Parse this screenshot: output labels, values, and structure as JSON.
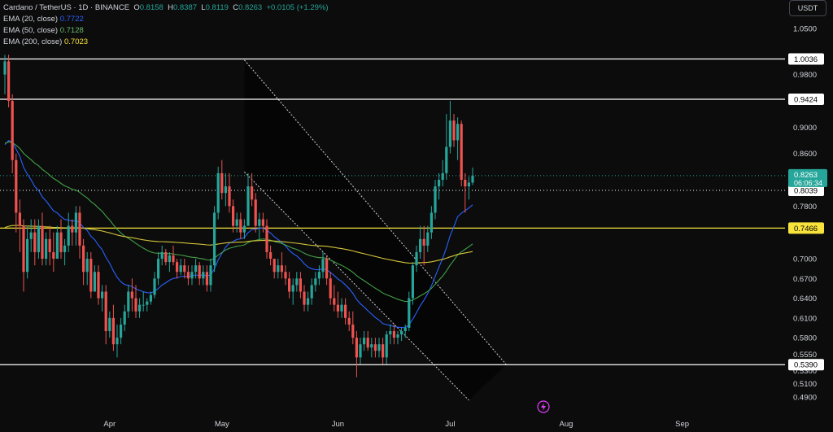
{
  "header": {
    "symbol": "Cardano / TetherUS · 1D · BINANCE",
    "o_label": "O",
    "o_value": "0.8158",
    "h_label": "H",
    "h_value": "0.8387",
    "l_label": "L",
    "l_value": "0.8119",
    "c_label": "C",
    "c_value": "0.8263",
    "change": "+0.0105 (+1.29%)",
    "currency": "USDT"
  },
  "indicators": [
    {
      "label": "EMA (20, close)",
      "value": "0.7722",
      "color": "#2962ff"
    },
    {
      "label": "EMA (50, close)",
      "value": "0.7128",
      "color": "#43a047"
    },
    {
      "label": "EMA (200, close)",
      "value": "0.7023",
      "color": "#f7e33b"
    }
  ],
  "chart_data": {
    "type": "candlestick",
    "y_ticks": [
      1.05,
      0.98,
      0.9,
      0.86,
      0.78,
      0.7,
      0.67,
      0.64,
      0.61,
      0.58,
      0.555,
      0.53,
      0.51,
      0.49
    ],
    "y_tick_labels": [
      "1.0500",
      "0.9800",
      "0.9000",
      "0.8600",
      "0.7800",
      "0.7000",
      "0.6700",
      "0.6400",
      "0.6100",
      "0.5800",
      "0.5550",
      "0.5300",
      "0.5100",
      "0.4900"
    ],
    "x_ticks": [
      {
        "label": "Apr",
        "index": 28
      },
      {
        "label": "May",
        "index": 58
      },
      {
        "label": "Jun",
        "index": 89
      },
      {
        "label": "Jul",
        "index": 119
      },
      {
        "label": "Aug",
        "index": 150
      },
      {
        "label": "Sep",
        "index": 181
      }
    ],
    "horizontal_levels": [
      {
        "value": 1.0036,
        "label": "1.0036",
        "color": "#ffffff",
        "style": "solid"
      },
      {
        "value": 0.9424,
        "label": "0.9424",
        "color": "#ffffff",
        "style": "solid"
      },
      {
        "value": 0.8039,
        "label": "0.8039",
        "color": "#ffffff",
        "style": "dotted"
      },
      {
        "value": 0.7466,
        "label": "0.7466",
        "color": "#f7e33b",
        "style": "solid"
      },
      {
        "value": 0.539,
        "label": "0.5390",
        "color": "#ffffff",
        "style": "solid"
      }
    ],
    "current_price": {
      "value": 0.8263,
      "label": "0.8263",
      "countdown": "06:06:34",
      "color": "#26a69a"
    },
    "channel": {
      "upper": [
        [
          64,
          1.002
        ],
        [
          134,
          0.539
        ]
      ],
      "lower": [
        [
          64,
          0.832
        ],
        [
          124,
          0.485
        ]
      ]
    },
    "candles": [
      [
        0.98,
        1.01,
        0.95,
        1.0
      ],
      [
        1.0,
        1.01,
        0.93,
        0.94
      ],
      [
        0.94,
        0.95,
        0.83,
        0.85
      ],
      [
        0.85,
        0.86,
        0.74,
        0.77
      ],
      [
        0.77,
        0.79,
        0.71,
        0.75
      ],
      [
        0.75,
        0.76,
        0.65,
        0.68
      ],
      [
        0.68,
        0.75,
        0.67,
        0.73
      ],
      [
        0.73,
        0.76,
        0.71,
        0.74
      ],
      [
        0.74,
        0.76,
        0.69,
        0.71
      ],
      [
        0.71,
        0.76,
        0.7,
        0.75
      ],
      [
        0.75,
        0.77,
        0.69,
        0.7
      ],
      [
        0.7,
        0.74,
        0.69,
        0.73
      ],
      [
        0.73,
        0.75,
        0.69,
        0.71
      ],
      [
        0.71,
        0.74,
        0.68,
        0.7
      ],
      [
        0.7,
        0.75,
        0.7,
        0.74
      ],
      [
        0.74,
        0.76,
        0.7,
        0.71
      ],
      [
        0.71,
        0.73,
        0.69,
        0.72
      ],
      [
        0.72,
        0.77,
        0.71,
        0.75
      ],
      [
        0.75,
        0.76,
        0.72,
        0.74
      ],
      [
        0.74,
        0.78,
        0.72,
        0.77
      ],
      [
        0.77,
        0.78,
        0.7,
        0.72
      ],
      [
        0.72,
        0.73,
        0.66,
        0.68
      ],
      [
        0.68,
        0.71,
        0.66,
        0.7
      ],
      [
        0.7,
        0.71,
        0.64,
        0.65
      ],
      [
        0.65,
        0.69,
        0.65,
        0.68
      ],
      [
        0.68,
        0.69,
        0.63,
        0.64
      ],
      [
        0.64,
        0.66,
        0.62,
        0.65
      ],
      [
        0.65,
        0.66,
        0.57,
        0.59
      ],
      [
        0.59,
        0.62,
        0.58,
        0.61
      ],
      [
        0.61,
        0.63,
        0.56,
        0.57
      ],
      [
        0.57,
        0.6,
        0.55,
        0.58
      ],
      [
        0.58,
        0.61,
        0.57,
        0.6
      ],
      [
        0.6,
        0.63,
        0.59,
        0.62
      ],
      [
        0.62,
        0.66,
        0.61,
        0.65
      ],
      [
        0.65,
        0.67,
        0.62,
        0.64
      ],
      [
        0.64,
        0.66,
        0.61,
        0.62
      ],
      [
        0.62,
        0.64,
        0.61,
        0.63
      ],
      [
        0.63,
        0.65,
        0.62,
        0.63
      ],
      [
        0.63,
        0.64,
        0.62,
        0.635
      ],
      [
        0.635,
        0.65,
        0.63,
        0.645
      ],
      [
        0.645,
        0.68,
        0.64,
        0.67
      ],
      [
        0.67,
        0.71,
        0.66,
        0.7
      ],
      [
        0.7,
        0.72,
        0.69,
        0.71
      ],
      [
        0.71,
        0.715,
        0.69,
        0.695
      ],
      [
        0.695,
        0.71,
        0.68,
        0.705
      ],
      [
        0.705,
        0.72,
        0.69,
        0.695
      ],
      [
        0.695,
        0.7,
        0.67,
        0.68
      ],
      [
        0.68,
        0.7,
        0.675,
        0.69
      ],
      [
        0.69,
        0.7,
        0.67,
        0.68
      ],
      [
        0.68,
        0.69,
        0.66,
        0.67
      ],
      [
        0.67,
        0.69,
        0.66,
        0.68
      ],
      [
        0.68,
        0.7,
        0.67,
        0.69
      ],
      [
        0.69,
        0.695,
        0.66,
        0.67
      ],
      [
        0.67,
        0.69,
        0.66,
        0.68
      ],
      [
        0.68,
        0.69,
        0.65,
        0.66
      ],
      [
        0.66,
        0.7,
        0.65,
        0.69
      ],
      [
        0.69,
        0.78,
        0.68,
        0.77
      ],
      [
        0.77,
        0.84,
        0.76,
        0.83
      ],
      [
        0.83,
        0.85,
        0.79,
        0.8
      ],
      [
        0.8,
        0.83,
        0.78,
        0.81
      ],
      [
        0.81,
        0.83,
        0.77,
        0.78
      ],
      [
        0.78,
        0.79,
        0.74,
        0.75
      ],
      [
        0.75,
        0.77,
        0.74,
        0.76
      ],
      [
        0.76,
        0.77,
        0.73,
        0.74
      ],
      [
        0.74,
        0.76,
        0.73,
        0.75
      ],
      [
        0.75,
        0.83,
        0.75,
        0.81
      ],
      [
        0.81,
        0.83,
        0.78,
        0.79
      ],
      [
        0.79,
        0.8,
        0.74,
        0.75
      ],
      [
        0.75,
        0.77,
        0.73,
        0.76
      ],
      [
        0.76,
        0.77,
        0.74,
        0.75
      ],
      [
        0.75,
        0.76,
        0.7,
        0.71
      ],
      [
        0.71,
        0.72,
        0.69,
        0.7
      ],
      [
        0.7,
        0.7,
        0.67,
        0.68
      ],
      [
        0.68,
        0.7,
        0.67,
        0.69
      ],
      [
        0.69,
        0.71,
        0.67,
        0.68
      ],
      [
        0.68,
        0.69,
        0.66,
        0.67
      ],
      [
        0.67,
        0.68,
        0.64,
        0.65
      ],
      [
        0.65,
        0.67,
        0.63,
        0.66
      ],
      [
        0.66,
        0.68,
        0.65,
        0.67
      ],
      [
        0.67,
        0.68,
        0.64,
        0.65
      ],
      [
        0.65,
        0.66,
        0.62,
        0.63
      ],
      [
        0.63,
        0.65,
        0.62,
        0.64
      ],
      [
        0.64,
        0.67,
        0.63,
        0.66
      ],
      [
        0.66,
        0.68,
        0.65,
        0.67
      ],
      [
        0.67,
        0.69,
        0.66,
        0.68
      ],
      [
        0.68,
        0.71,
        0.67,
        0.7
      ],
      [
        0.7,
        0.705,
        0.66,
        0.67
      ],
      [
        0.67,
        0.68,
        0.63,
        0.64
      ],
      [
        0.64,
        0.66,
        0.62,
        0.63
      ],
      [
        0.63,
        0.65,
        0.61,
        0.62
      ],
      [
        0.62,
        0.64,
        0.61,
        0.63
      ],
      [
        0.63,
        0.64,
        0.6,
        0.61
      ],
      [
        0.61,
        0.62,
        0.59,
        0.6
      ],
      [
        0.6,
        0.62,
        0.57,
        0.58
      ],
      [
        0.58,
        0.59,
        0.52,
        0.55
      ],
      [
        0.55,
        0.58,
        0.54,
        0.57
      ],
      [
        0.57,
        0.59,
        0.56,
        0.58
      ],
      [
        0.58,
        0.59,
        0.56,
        0.565
      ],
      [
        0.565,
        0.58,
        0.55,
        0.57
      ],
      [
        0.57,
        0.58,
        0.55,
        0.56
      ],
      [
        0.56,
        0.58,
        0.55,
        0.57
      ],
      [
        0.57,
        0.58,
        0.54,
        0.55
      ],
      [
        0.55,
        0.59,
        0.54,
        0.585
      ],
      [
        0.585,
        0.6,
        0.57,
        0.59
      ],
      [
        0.59,
        0.6,
        0.57,
        0.58
      ],
      [
        0.58,
        0.59,
        0.57,
        0.585
      ],
      [
        0.585,
        0.595,
        0.575,
        0.59
      ],
      [
        0.59,
        0.6,
        0.58,
        0.595
      ],
      [
        0.595,
        0.65,
        0.59,
        0.64
      ],
      [
        0.64,
        0.695,
        0.63,
        0.69
      ],
      [
        0.69,
        0.72,
        0.68,
        0.71
      ],
      [
        0.71,
        0.75,
        0.7,
        0.73
      ],
      [
        0.73,
        0.75,
        0.69,
        0.72
      ],
      [
        0.72,
        0.75,
        0.71,
        0.74
      ],
      [
        0.74,
        0.78,
        0.73,
        0.77
      ],
      [
        0.77,
        0.82,
        0.76,
        0.81
      ],
      [
        0.81,
        0.83,
        0.79,
        0.82
      ],
      [
        0.82,
        0.85,
        0.81,
        0.83
      ],
      [
        0.83,
        0.92,
        0.82,
        0.87
      ],
      [
        0.87,
        0.94,
        0.86,
        0.91
      ],
      [
        0.91,
        0.92,
        0.87,
        0.88
      ],
      [
        0.88,
        0.915,
        0.85,
        0.905
      ],
      [
        0.905,
        0.91,
        0.81,
        0.82
      ],
      [
        0.82,
        0.83,
        0.77,
        0.81
      ],
      [
        0.81,
        0.825,
        0.79,
        0.8158
      ],
      [
        0.8158,
        0.8387,
        0.8119,
        0.8263
      ]
    ]
  }
}
